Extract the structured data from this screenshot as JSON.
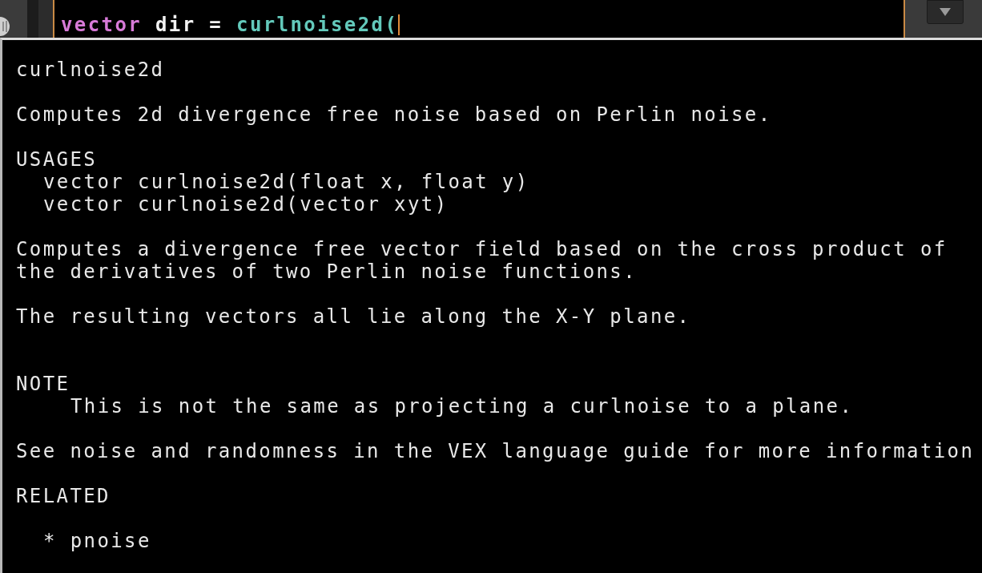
{
  "editor": {
    "code_line": [
      {
        "kind": "keyword",
        "text": "vector"
      },
      {
        "kind": "plain",
        "text": " dir = "
      },
      {
        "kind": "function",
        "text": "curlnoise2d("
      }
    ]
  },
  "help_popup": {
    "blocks": [
      {
        "kind": "paragraph",
        "lines": [
          "curlnoise2d"
        ]
      },
      {
        "kind": "paragraph",
        "lines": [
          "Computes 2d divergence free noise based on Perlin noise."
        ]
      },
      {
        "kind": "usages",
        "heading": "USAGES",
        "items": [
          "vector curlnoise2d(float x, float y)",
          "vector curlnoise2d(vector xyt)"
        ]
      },
      {
        "kind": "paragraph",
        "lines": [
          "Computes a divergence free vector field based on the cross product of",
          "the derivatives of two Perlin noise functions."
        ]
      },
      {
        "kind": "paragraph",
        "lines": [
          "The resulting vectors all lie along the X-Y plane."
        ]
      },
      {
        "kind": "note",
        "heading": "NOTE",
        "items": [
          "This is not the same as projecting a curlnoise to a plane."
        ]
      },
      {
        "kind": "paragraph",
        "lines": [
          "See noise and randomness in the VEX language guide for more information"
        ]
      },
      {
        "kind": "related",
        "heading": "RELATED",
        "items": [
          "* pnoise"
        ]
      }
    ]
  }
}
